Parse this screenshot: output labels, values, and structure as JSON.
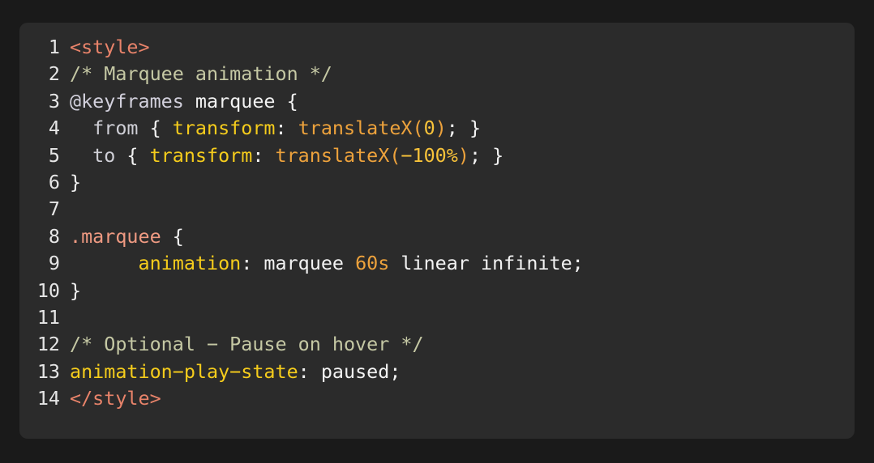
{
  "editor": {
    "language": "css",
    "background_color": "#1a1a1a",
    "panel_color": "#2b2b2b",
    "gutter_color": "#e6e6e6",
    "line_count": 14,
    "lines": [
      {
        "number": "1",
        "text": "<style>",
        "tokens": [
          {
            "t": "<style>",
            "c": "t-tag"
          }
        ]
      },
      {
        "number": "2",
        "text": "/* Marquee animation */",
        "tokens": [
          {
            "t": "/* Marquee animation */",
            "c": "t-comment"
          }
        ]
      },
      {
        "number": "3",
        "text": "@keyframes marquee {",
        "tokens": [
          {
            "t": "@keyframes",
            "c": "t-atrule"
          },
          {
            "t": " marquee {",
            "c": "t-plain"
          }
        ]
      },
      {
        "number": "4",
        "text": "  from { transform: translateX(0); }",
        "tokens": [
          {
            "t": "  ",
            "c": "t-plain"
          },
          {
            "t": "from",
            "c": "t-keyword"
          },
          {
            "t": " { ",
            "c": "t-punct"
          },
          {
            "t": "transform",
            "c": "t-prop"
          },
          {
            "t": ": ",
            "c": "t-punct"
          },
          {
            "t": "translateX(",
            "c": "t-func"
          },
          {
            "t": "0",
            "c": "t-number"
          },
          {
            "t": ")",
            "c": "t-func"
          },
          {
            "t": "; }",
            "c": "t-punct"
          }
        ]
      },
      {
        "number": "5",
        "text": "  to { transform: translateX(-100%); }",
        "tokens": [
          {
            "t": "  ",
            "c": "t-plain"
          },
          {
            "t": "to",
            "c": "t-keyword"
          },
          {
            "t": " { ",
            "c": "t-punct"
          },
          {
            "t": "transform",
            "c": "t-prop"
          },
          {
            "t": ": ",
            "c": "t-punct"
          },
          {
            "t": "translateX(",
            "c": "t-func"
          },
          {
            "t": "−100%",
            "c": "t-number"
          },
          {
            "t": ")",
            "c": "t-func"
          },
          {
            "t": "; }",
            "c": "t-punct"
          }
        ]
      },
      {
        "number": "6",
        "text": "}",
        "tokens": [
          {
            "t": "}",
            "c": "t-punct"
          }
        ]
      },
      {
        "number": "7",
        "text": "",
        "tokens": []
      },
      {
        "number": "8",
        "text": ".marquee {",
        "tokens": [
          {
            "t": ".marquee",
            "c": "t-selector"
          },
          {
            "t": " {",
            "c": "t-punct"
          }
        ]
      },
      {
        "number": "9",
        "text": "      animation: marquee 60s linear infinite;",
        "tokens": [
          {
            "t": "      ",
            "c": "t-plain"
          },
          {
            "t": "animation",
            "c": "t-prop"
          },
          {
            "t": ": ",
            "c": "t-punct"
          },
          {
            "t": "marquee ",
            "c": "t-plain"
          },
          {
            "t": "60s",
            "c": "t-func"
          },
          {
            "t": " linear infinite;",
            "c": "t-plain"
          }
        ]
      },
      {
        "number": "10",
        "text": "}",
        "tokens": [
          {
            "t": "}",
            "c": "t-punct"
          }
        ]
      },
      {
        "number": "11",
        "text": "",
        "tokens": []
      },
      {
        "number": "12",
        "text": "/* Optional − Pause on hover */",
        "tokens": [
          {
            "t": "/* Optional − Pause on hover */",
            "c": "t-comment"
          }
        ]
      },
      {
        "number": "13",
        "text": "animation-play-state: paused;",
        "tokens": [
          {
            "t": "animation−play−state",
            "c": "t-prop"
          },
          {
            "t": ": ",
            "c": "t-punct"
          },
          {
            "t": "paused;",
            "c": "t-plain"
          }
        ]
      },
      {
        "number": "14",
        "text": "</style>",
        "tokens": [
          {
            "t": "</style>",
            "c": "t-tag"
          }
        ]
      }
    ]
  }
}
